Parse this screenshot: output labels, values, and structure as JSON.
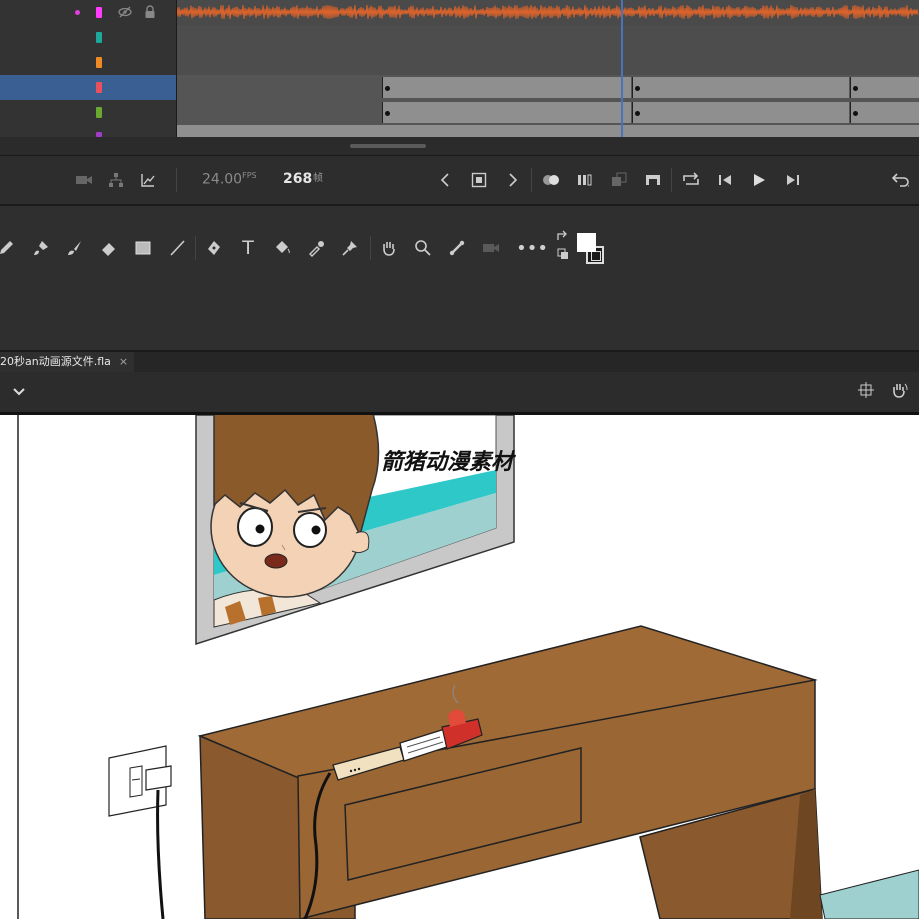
{
  "timeline": {
    "layers": [
      {
        "dot_color": "#e040e0",
        "chip_color": "#ff3cff",
        "hidden_icon": "eye-slash-icon",
        "locked_icon": "lock-icon",
        "selected": false,
        "waveform": true
      },
      {
        "chip_color": "#1ea89a",
        "selected": false
      },
      {
        "chip_color": "#f08a24",
        "selected": false
      },
      {
        "chip_color": "#e8505b",
        "selected": true
      },
      {
        "chip_color": "#6aa832",
        "selected": false
      },
      {
        "chip_color": "#a03cc8",
        "selected": false
      }
    ],
    "current_frame": "268",
    "frame_unit": "帧",
    "fps_value": "24.00",
    "fps_unit": "FPS"
  },
  "controls": {
    "icons": [
      "camera-icon",
      "layer-parenting-icon",
      "graph-icon",
      "prev-keyframe-icon",
      "insert-keyframe-icon",
      "next-keyframe-icon",
      "onion-skin-icon",
      "onion-skin-outline-icon",
      "edit-multiple-frames-icon",
      "frame-span-icon",
      "loop-icon",
      "step-back-icon",
      "play-icon",
      "step-forward-icon",
      "undo-icon"
    ]
  },
  "tools": {
    "icons": [
      "pencil-icon",
      "paint-brush-icon",
      "brush-icon",
      "eraser-icon",
      "rectangle-icon",
      "line-icon",
      "pen-icon",
      "text-icon",
      "paint-bucket-icon",
      "eyedropper-icon",
      "pin-icon",
      "hand-icon",
      "zoom-icon",
      "bone-icon",
      "camera-icon",
      "more-icon",
      "swap-colors-icon",
      "fill-color-swatch"
    ],
    "fill_color": "#ffffff",
    "stroke_color": "#1a1a1a"
  },
  "document": {
    "tab_label": "20秒an动画源文件.fla",
    "close_glyph": "×",
    "edit_bar_dropdown_glyph": "⌄"
  },
  "stage": {
    "watermark": "箭猪动漫素材",
    "colors": {
      "desk": "#9a6634",
      "desk_side": "#7b4f27",
      "wall": "#ffffff",
      "frame": "#c8c8c8",
      "window_teal": "#2ec8c8",
      "window_light": "#9ed0d0",
      "hair": "#8b5a2b",
      "skin": "#f4d2b5"
    }
  }
}
